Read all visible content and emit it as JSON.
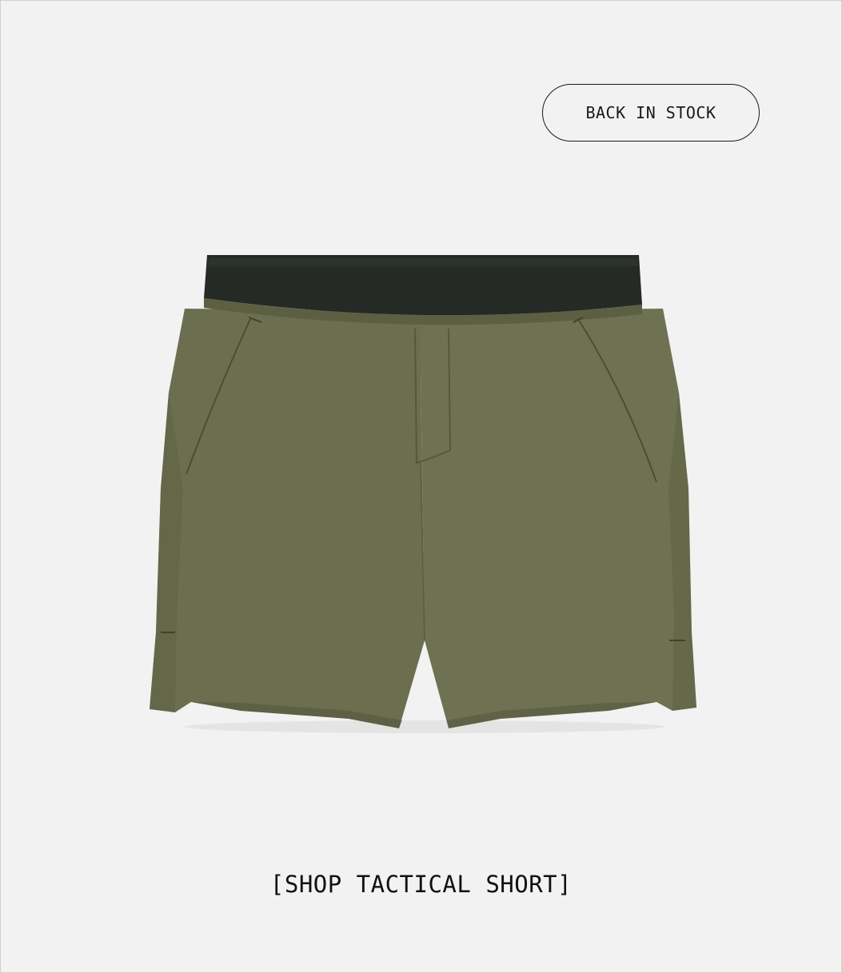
{
  "badge": {
    "label": "BACK IN STOCK"
  },
  "product": {
    "image_icon": "olive-shorts-illustration",
    "colors": {
      "fabric": "#6b6e4f",
      "fabric_shade": "#5c5f42",
      "waistband": "#252a26",
      "background": "#f2f2f2"
    }
  },
  "cta": {
    "label": "[SHOP TACTICAL SHORT]"
  }
}
